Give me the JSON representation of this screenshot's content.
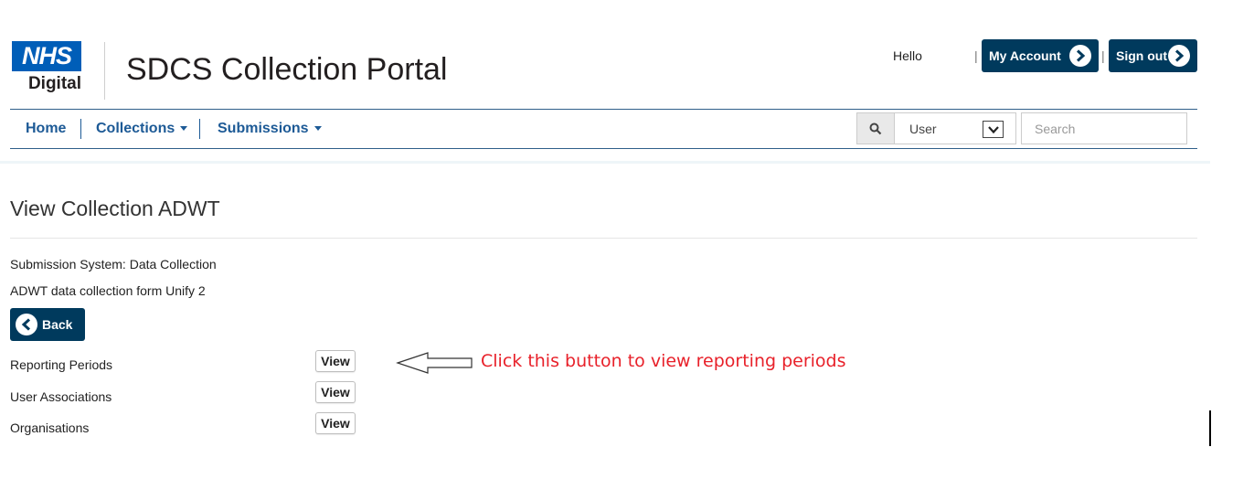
{
  "header": {
    "logo_nhs": "NHS",
    "logo_digital": "Digital",
    "portal_title": "SDCS Collection Portal",
    "greeting": "Hello",
    "separator": "|",
    "my_account_label": "My Account",
    "sign_out_label": "Sign out"
  },
  "nav": {
    "items": [
      {
        "label": "Home"
      },
      {
        "label": "Collections"
      },
      {
        "label": "Submissions"
      }
    ],
    "search": {
      "icon": "search-icon",
      "select_value": "User",
      "placeholder": "Search"
    }
  },
  "main": {
    "title": "View Collection ADWT",
    "submission_system": "Submission System: Data Collection",
    "form_name": "ADWT data collection form Unify 2",
    "back_label": "Back",
    "rows": [
      {
        "label": "Reporting Periods",
        "button": "View"
      },
      {
        "label": "User Associations",
        "button": "View"
      },
      {
        "label": "Organisations",
        "button": "View"
      }
    ]
  },
  "annotation": {
    "text": "Click this button to view reporting periods",
    "color": "#e8212a"
  },
  "colors": {
    "brand_blue": "#005eb8",
    "dark_button": "#003a5d",
    "nav_link": "#1d5a96"
  }
}
